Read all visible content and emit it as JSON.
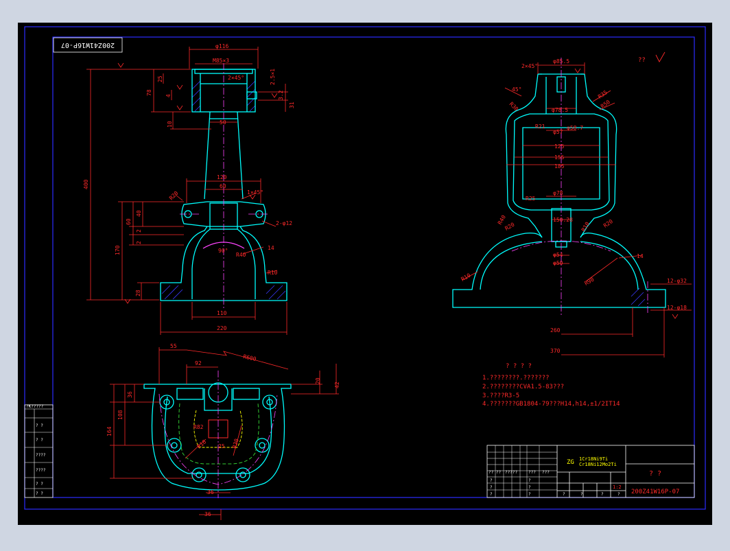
{
  "drawing": {
    "colors": {
      "background": "#000000",
      "frame": "#2c2cff",
      "outline": "#00ffff",
      "dimension": "#ff2a2a",
      "centerline": "#ff44ff",
      "hatch": "#3a3aff",
      "hidden": "#33cc33",
      "note": "#ff2a2a",
      "white": "#ffffff",
      "yellow": "#ffff00"
    },
    "corner_code": "200Z41W16P-07",
    "front_view": {
      "dims": {
        "d116": "φ116",
        "thread": "M85×3",
        "chamfer": "2×45°",
        "gap": "2.5×1",
        "h78": "78",
        "h25": "25",
        "h4": "4",
        "h10": "10",
        "h31": "31",
        "h400": "400",
        "w50": "50",
        "w120": "120",
        "w60": "60",
        "r20": "R20",
        "c145": "1×45°",
        "holes": "2-φ12",
        "h60": "60",
        "h40": "40",
        "h2a": "2",
        "h2b": "2",
        "h170": "170",
        "a90": "90°",
        "r40": "R40",
        "t14": "14",
        "r10": "R10",
        "h28": "28",
        "w110": "110",
        "w220": "220",
        "v34": "3.2"
      }
    },
    "side_view": {
      "dims": {
        "d85": "φ85.5",
        "chamfer": "2×45°",
        "a45": "45°",
        "r35": "R35",
        "r50": "R50",
        "r30": "R30",
        "d785": "φ78.5",
        "r21": "R21",
        "d57": "φ57",
        "d58": "φ58.7",
        "w125": "125",
        "w155": "155",
        "w185": "185",
        "d78": "φ78",
        "r25": "R25",
        "r40": "R40",
        "r20a": "R20",
        "w150": "150.28",
        "r10b": "R10",
        "r20b": "R20",
        "d54": "φ54",
        "d50": "φ50",
        "r90": "R90",
        "t14": "14",
        "r10": "R10",
        "holes32": "12-φ32",
        "holes18": "12-φ18",
        "w260": "260",
        "w370": "370",
        "rough": "??"
      }
    },
    "plan_view": {
      "dims": {
        "w55": "55",
        "r600": "R600",
        "w92": "92",
        "h20": "20",
        "h42": "42",
        "h36": "36",
        "h108": "108",
        "h164": "164",
        "r82": "R82",
        "r18": "R18",
        "w25": "25",
        "r30": "R30",
        "w36": "36",
        "w36b": "36"
      }
    },
    "notes": {
      "title": "? ? ? ?",
      "lines": [
        "1.????????.???????",
        "2.????????CVA1.5-83???",
        "3.????R3-5",
        "4.???????GB1804-79???H14,h14,±1/2IT14"
      ]
    },
    "title_block": {
      "material_prefix": "ZG",
      "material_1": "1Cr18Ni9Ti",
      "material_2": "Cr18Ni12Mo2Ti",
      "part_name": "? ?",
      "scale": "1:2",
      "drawing_no": "200Z41W16P-07",
      "cell_q": "?",
      "row_labels": [
        "?? ??",
        "?????",
        "???",
        "???"
      ],
      "small": "?"
    },
    "left_strip": {
      "label": "?K?????",
      "cells": [
        "? ?",
        "? ?",
        "????",
        "????",
        "? ?",
        "? ?"
      ]
    }
  }
}
